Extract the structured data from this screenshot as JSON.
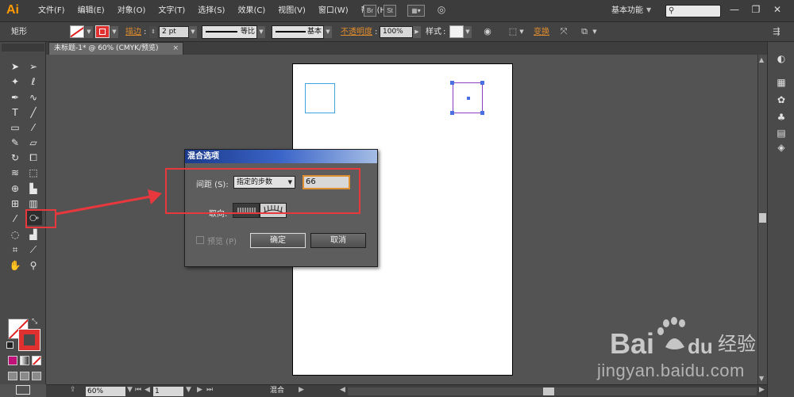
{
  "app": {
    "logo": "Ai"
  },
  "menubar": {
    "items": [
      "文件(F)",
      "编辑(E)",
      "对象(O)",
      "文字(T)",
      "选择(S)",
      "效果(C)",
      "视图(V)",
      "窗口(W)",
      "帮助(H)"
    ],
    "bridge_icon": "Br",
    "stock_icon": "St",
    "workspace": "基本功能",
    "search_icon": "search-icon",
    "window_controls": [
      "minimize-icon",
      "restore-icon",
      "close-icon"
    ]
  },
  "controlbar": {
    "selection_kind": "矩形",
    "stroke_link": "描边",
    "stroke_weight": "2 pt",
    "stroke_profile": "等比",
    "brush_label": "基本",
    "opacity_link": "不透明度",
    "opacity_value": "100%",
    "style_label": "样式",
    "transform_link": "变换"
  },
  "document": {
    "tab_label": "未标题-1* @ 60% (CMYK/预览)",
    "tab_close": "×"
  },
  "colors": {
    "fill": "#ffffff",
    "stroke": "#e03030",
    "square_1_stroke": "#3ea6de",
    "square_2_stroke": "#8a3fc0",
    "annotation": "#e8383d"
  },
  "dialog": {
    "title": "混合选项",
    "spacing_label": "间距 (S):",
    "spacing_value": "指定的步数",
    "steps_value": "66",
    "orientation_label": "取向:",
    "preview_label": "预览 (P)",
    "preview_checked": false,
    "ok_label": "确定",
    "cancel_label": "取消"
  },
  "statusbar": {
    "zoom": "60%",
    "page": "1",
    "status": "混合"
  },
  "watermark": {
    "brand": "Baidu经验",
    "url": "jingyan.baidu.com"
  }
}
